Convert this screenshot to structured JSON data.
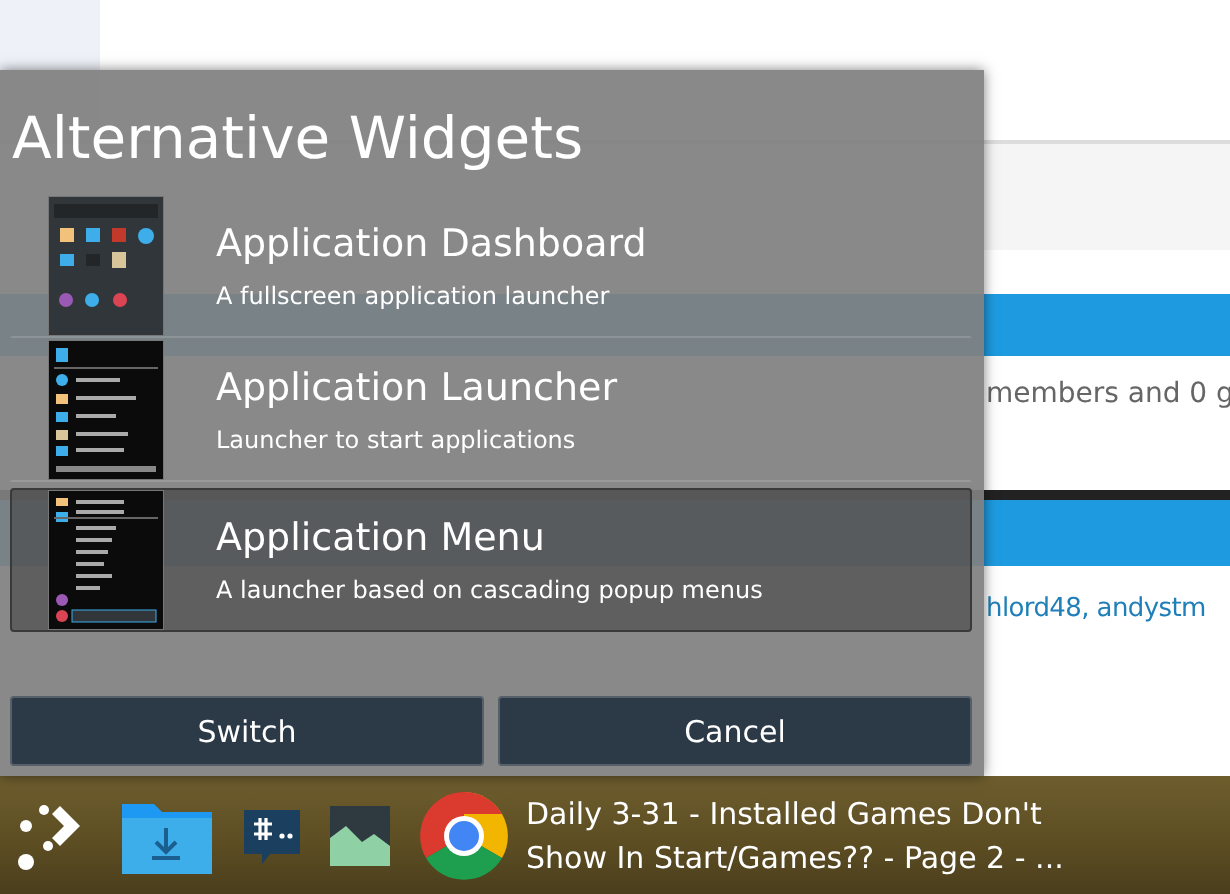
{
  "background_page": {
    "status_text": "members and 0 g",
    "link_text": "hlord48, andystm"
  },
  "dialog": {
    "title": "Alternative Widgets",
    "widgets": [
      {
        "kind": "dashboard",
        "name": "Application Dashboard",
        "description": "A fullscreen application launcher",
        "selected": false
      },
      {
        "kind": "launcher",
        "name": "Application Launcher",
        "description": "Launcher to start applications",
        "selected": false
      },
      {
        "kind": "menu",
        "name": "Application Menu",
        "description": "A launcher based on cascading popup menus",
        "selected": true
      }
    ],
    "buttons": [
      "Switch",
      "Cancel"
    ]
  },
  "taskbar": {
    "window_title": "Daily 3-31 - Installed Games Don't Show In Start/Games?? - Page 2 - ..."
  }
}
